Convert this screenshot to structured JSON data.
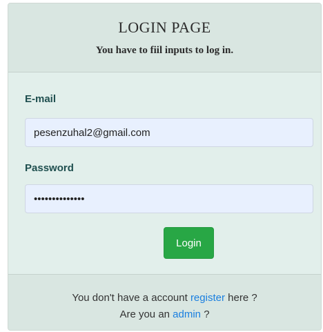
{
  "header": {
    "title": "LOGIN PAGE",
    "subtitle": "You have to fiil inputs to log in."
  },
  "form": {
    "email_label": "E-mail",
    "email_value": "pesenzuhal2@gmail.com",
    "password_label": "Password",
    "password_value": "password123456",
    "login_button": "Login"
  },
  "footer": {
    "register_prefix": "You don't have a account ",
    "register_link": "register",
    "register_suffix": " here ?",
    "admin_prefix": "Are you an ",
    "admin_link": "admin",
    "admin_suffix": " ?"
  },
  "colors": {
    "accent_button": "#28a745",
    "link": "#1a7fe0",
    "card_background": "#e2efeb"
  }
}
